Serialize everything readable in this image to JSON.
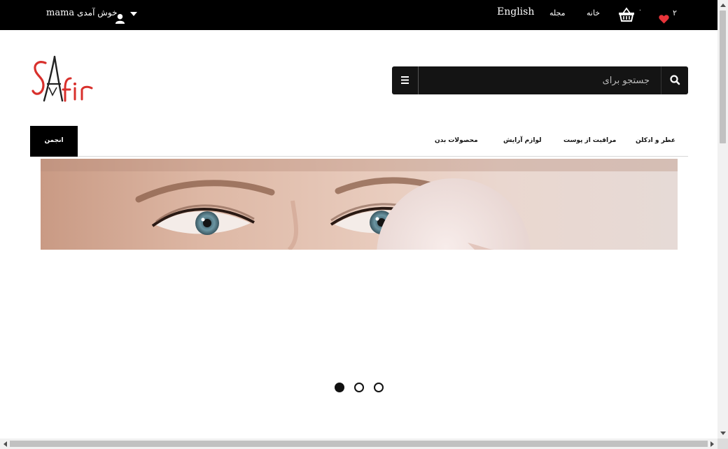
{
  "topbar": {
    "welcome_text": "خوش آمدی",
    "username": "mama",
    "language": "English",
    "links": {
      "magazine": "مجله",
      "home": "خانه"
    },
    "basket_count": "۰",
    "wishlist_count": "۲",
    "icons": {
      "user": "user-icon",
      "caret": "caret-down-icon",
      "basket": "basket-icon",
      "heart": "heart-icon"
    },
    "colors": {
      "heart": "#e8343a"
    }
  },
  "logo": {
    "text": "SAfir",
    "color": "#d8302c"
  },
  "search": {
    "placeholder": "جستجو برای",
    "icons": {
      "menu": "bars-icon",
      "search": "search-icon"
    }
  },
  "nav": {
    "forum": "انجمن",
    "items": [
      "عطر و ادکلن",
      "مراقبت از پوست",
      "لوازم آرایش",
      "محصولات بدن"
    ]
  },
  "slider": {
    "slide_count": 3,
    "active_index": 0
  }
}
